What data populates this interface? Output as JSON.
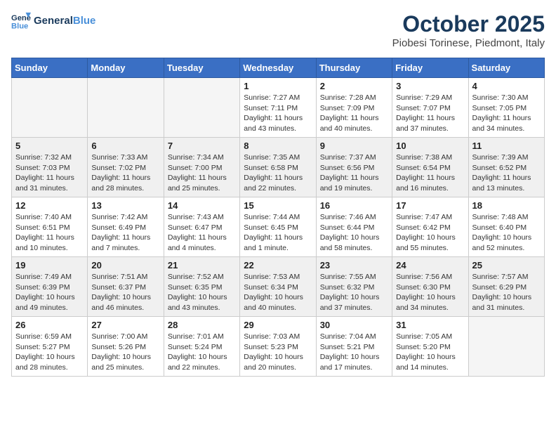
{
  "header": {
    "logo_line1": "General",
    "logo_line2": "Blue",
    "month": "October 2025",
    "location": "Piobesi Torinese, Piedmont, Italy"
  },
  "weekdays": [
    "Sunday",
    "Monday",
    "Tuesday",
    "Wednesday",
    "Thursday",
    "Friday",
    "Saturday"
  ],
  "weeks": [
    [
      {
        "day": "",
        "info": ""
      },
      {
        "day": "",
        "info": ""
      },
      {
        "day": "",
        "info": ""
      },
      {
        "day": "1",
        "info": "Sunrise: 7:27 AM\nSunset: 7:11 PM\nDaylight: 11 hours\nand 43 minutes."
      },
      {
        "day": "2",
        "info": "Sunrise: 7:28 AM\nSunset: 7:09 PM\nDaylight: 11 hours\nand 40 minutes."
      },
      {
        "day": "3",
        "info": "Sunrise: 7:29 AM\nSunset: 7:07 PM\nDaylight: 11 hours\nand 37 minutes."
      },
      {
        "day": "4",
        "info": "Sunrise: 7:30 AM\nSunset: 7:05 PM\nDaylight: 11 hours\nand 34 minutes."
      }
    ],
    [
      {
        "day": "5",
        "info": "Sunrise: 7:32 AM\nSunset: 7:03 PM\nDaylight: 11 hours\nand 31 minutes."
      },
      {
        "day": "6",
        "info": "Sunrise: 7:33 AM\nSunset: 7:02 PM\nDaylight: 11 hours\nand 28 minutes."
      },
      {
        "day": "7",
        "info": "Sunrise: 7:34 AM\nSunset: 7:00 PM\nDaylight: 11 hours\nand 25 minutes."
      },
      {
        "day": "8",
        "info": "Sunrise: 7:35 AM\nSunset: 6:58 PM\nDaylight: 11 hours\nand 22 minutes."
      },
      {
        "day": "9",
        "info": "Sunrise: 7:37 AM\nSunset: 6:56 PM\nDaylight: 11 hours\nand 19 minutes."
      },
      {
        "day": "10",
        "info": "Sunrise: 7:38 AM\nSunset: 6:54 PM\nDaylight: 11 hours\nand 16 minutes."
      },
      {
        "day": "11",
        "info": "Sunrise: 7:39 AM\nSunset: 6:52 PM\nDaylight: 11 hours\nand 13 minutes."
      }
    ],
    [
      {
        "day": "12",
        "info": "Sunrise: 7:40 AM\nSunset: 6:51 PM\nDaylight: 11 hours\nand 10 minutes."
      },
      {
        "day": "13",
        "info": "Sunrise: 7:42 AM\nSunset: 6:49 PM\nDaylight: 11 hours\nand 7 minutes."
      },
      {
        "day": "14",
        "info": "Sunrise: 7:43 AM\nSunset: 6:47 PM\nDaylight: 11 hours\nand 4 minutes."
      },
      {
        "day": "15",
        "info": "Sunrise: 7:44 AM\nSunset: 6:45 PM\nDaylight: 11 hours\nand 1 minute."
      },
      {
        "day": "16",
        "info": "Sunrise: 7:46 AM\nSunset: 6:44 PM\nDaylight: 10 hours\nand 58 minutes."
      },
      {
        "day": "17",
        "info": "Sunrise: 7:47 AM\nSunset: 6:42 PM\nDaylight: 10 hours\nand 55 minutes."
      },
      {
        "day": "18",
        "info": "Sunrise: 7:48 AM\nSunset: 6:40 PM\nDaylight: 10 hours\nand 52 minutes."
      }
    ],
    [
      {
        "day": "19",
        "info": "Sunrise: 7:49 AM\nSunset: 6:39 PM\nDaylight: 10 hours\nand 49 minutes."
      },
      {
        "day": "20",
        "info": "Sunrise: 7:51 AM\nSunset: 6:37 PM\nDaylight: 10 hours\nand 46 minutes."
      },
      {
        "day": "21",
        "info": "Sunrise: 7:52 AM\nSunset: 6:35 PM\nDaylight: 10 hours\nand 43 minutes."
      },
      {
        "day": "22",
        "info": "Sunrise: 7:53 AM\nSunset: 6:34 PM\nDaylight: 10 hours\nand 40 minutes."
      },
      {
        "day": "23",
        "info": "Sunrise: 7:55 AM\nSunset: 6:32 PM\nDaylight: 10 hours\nand 37 minutes."
      },
      {
        "day": "24",
        "info": "Sunrise: 7:56 AM\nSunset: 6:30 PM\nDaylight: 10 hours\nand 34 minutes."
      },
      {
        "day": "25",
        "info": "Sunrise: 7:57 AM\nSunset: 6:29 PM\nDaylight: 10 hours\nand 31 minutes."
      }
    ],
    [
      {
        "day": "26",
        "info": "Sunrise: 6:59 AM\nSunset: 5:27 PM\nDaylight: 10 hours\nand 28 minutes."
      },
      {
        "day": "27",
        "info": "Sunrise: 7:00 AM\nSunset: 5:26 PM\nDaylight: 10 hours\nand 25 minutes."
      },
      {
        "day": "28",
        "info": "Sunrise: 7:01 AM\nSunset: 5:24 PM\nDaylight: 10 hours\nand 22 minutes."
      },
      {
        "day": "29",
        "info": "Sunrise: 7:03 AM\nSunset: 5:23 PM\nDaylight: 10 hours\nand 20 minutes."
      },
      {
        "day": "30",
        "info": "Sunrise: 7:04 AM\nSunset: 5:21 PM\nDaylight: 10 hours\nand 17 minutes."
      },
      {
        "day": "31",
        "info": "Sunrise: 7:05 AM\nSunset: 5:20 PM\nDaylight: 10 hours\nand 14 minutes."
      },
      {
        "day": "",
        "info": ""
      }
    ]
  ]
}
